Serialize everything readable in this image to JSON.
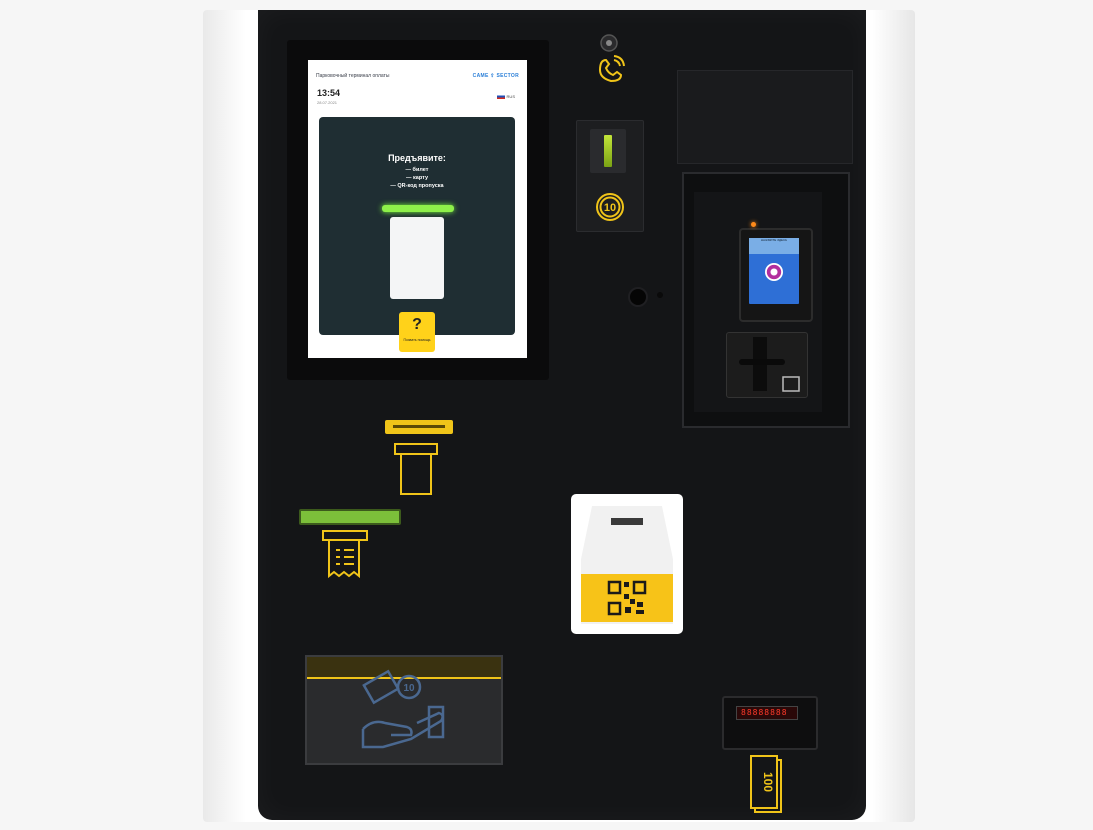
{
  "kiosk": {
    "screen": {
      "location": "Парковочный терминал оплаты",
      "brand": "CAME ⇧ SECTOR",
      "time": "13:54",
      "date": "28.07.2021",
      "language": "RUS",
      "title": "Предъявите:",
      "items": [
        "— билет",
        "— карту",
        "— QR-код пропуска"
      ],
      "help_symbol": "?",
      "help_label": "Позвать помощь",
      "pinpad_header": "НАЖМИТЕ ЗДЕСЬ"
    },
    "coin_value": "10",
    "bill_value": "100",
    "bill_display": "88888888",
    "colors": {
      "accent_yellow": "#f0c419",
      "panel": "#141517",
      "frame": "#ffffff",
      "screen_card": "#1f2e33",
      "led_green": "#8ef04a"
    },
    "icons": [
      "call-icon",
      "coin-icon",
      "ticket-icon",
      "receipt-icon",
      "qr-icon",
      "cash-change-icon",
      "banknote-icon",
      "contactless-card-icon"
    ]
  }
}
